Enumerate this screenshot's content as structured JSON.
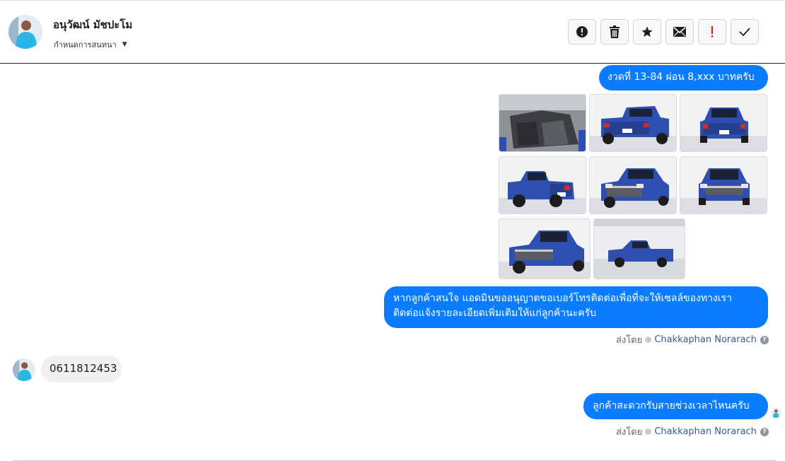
{
  "header": {
    "name": "อนุวัฒน์ มัชปะโม",
    "subtitle": "กำหนดการสนทนา",
    "actions": [
      {
        "name": "alert-icon"
      },
      {
        "name": "trash-icon"
      },
      {
        "name": "star-icon"
      },
      {
        "name": "envelope-icon"
      },
      {
        "name": "exclamation-icon"
      },
      {
        "name": "check-icon"
      }
    ]
  },
  "messages": {
    "m1": "งวดที่ 13-84 ผ่อน 8,xxx บาทครับ",
    "m2_line1": "หากลูกค้าสนใจ แอดมินขออนุญาตขอเบอร์โทรติดต่อเพื่อที่จะให้เซลล์ของทางเรา",
    "m2_line2": "ติดต่อแจ้งรายละเอียดเพิ่มเติมให้แก่ลูกค้านะครับ",
    "incoming": "0611812453",
    "m3": "ลูกค้าสะดวกรับสายช่วงเวลาไหนครับ"
  },
  "sent_by": {
    "prefix": "ส่งโดย",
    "agent": "Chakkaphan Norarach"
  },
  "colors": {
    "bubble_out": "#0a7cff",
    "bubble_in": "#f0f0f0",
    "truck_blue": "#2f4fb0"
  }
}
